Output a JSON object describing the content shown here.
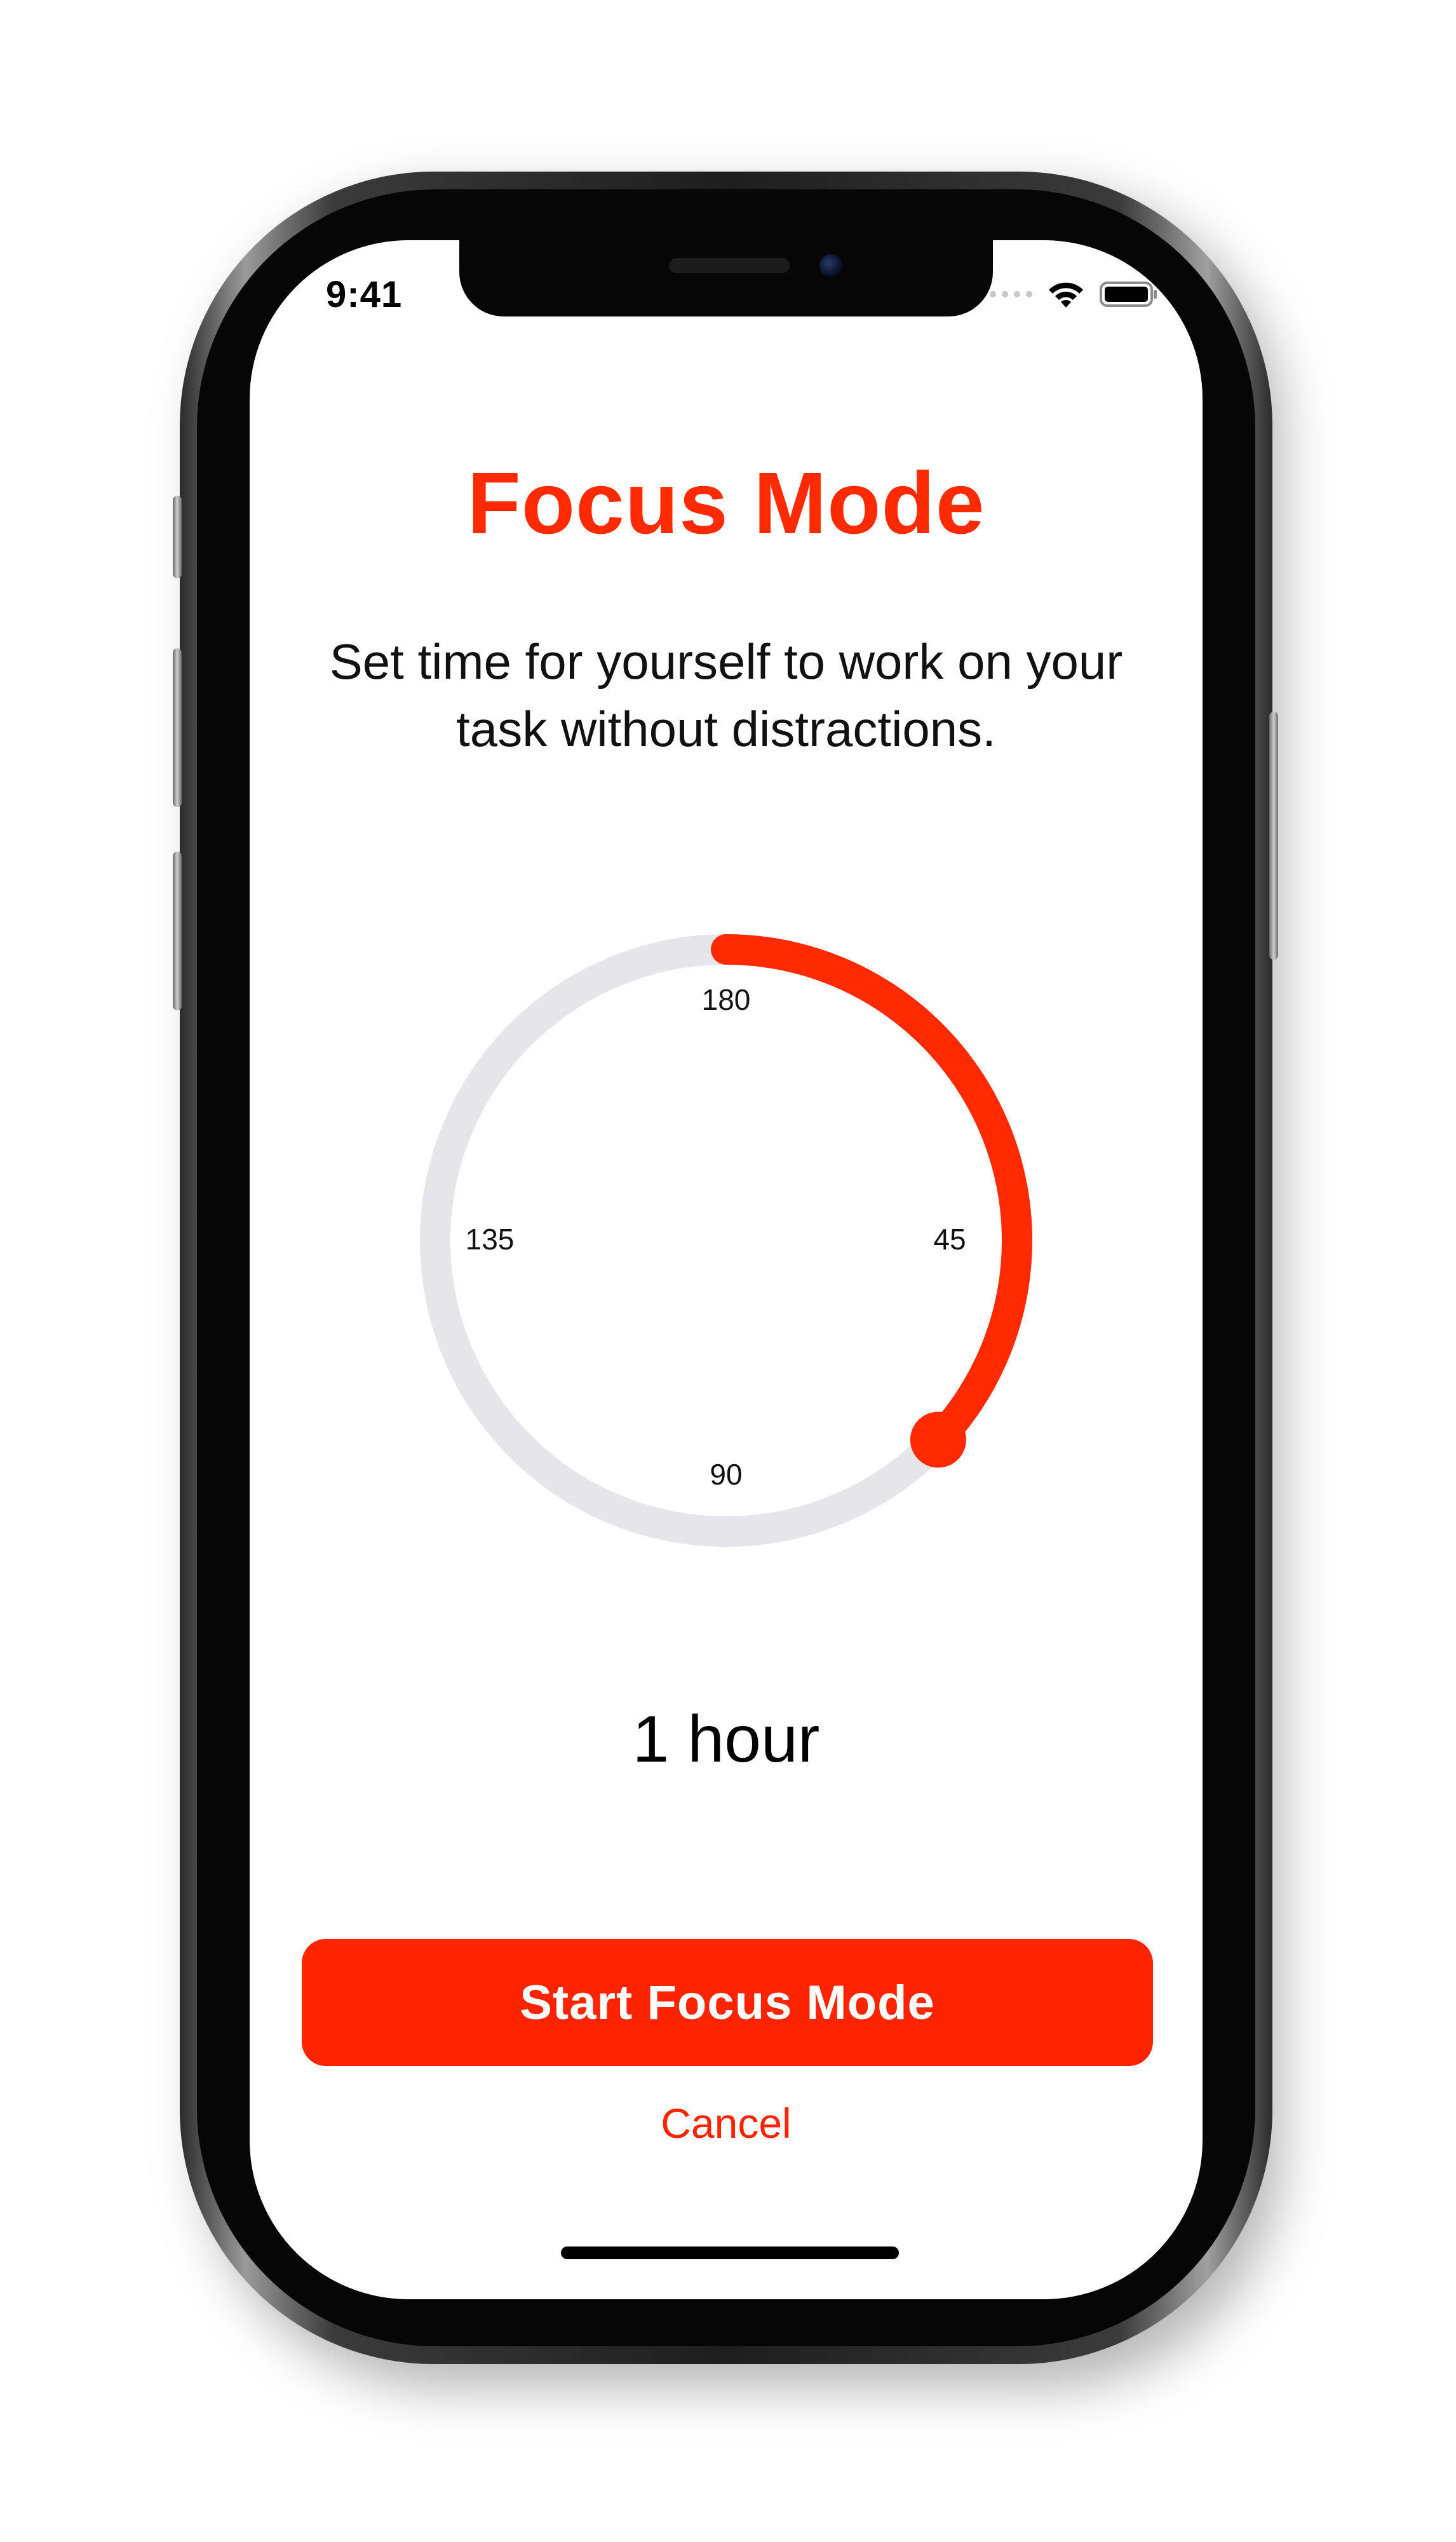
{
  "status_bar": {
    "time": "9:41",
    "icons": [
      "signal-dots-icon",
      "wifi-icon",
      "battery-icon"
    ]
  },
  "main": {
    "title": "Focus Mode",
    "subtitle_line1": "Set time for yourself to work on your",
    "subtitle_line2": "task without distractions.",
    "dial": {
      "labels": {
        "top": "180",
        "right": "45",
        "bottom": "90",
        "left": "135"
      },
      "selected_fraction": 0.37
    },
    "duration": "1 hour",
    "start_button_label": "Start Focus Mode",
    "cancel_label": "Cancel"
  },
  "colors": {
    "accent": "#FF2A00",
    "track": "#E6E6EA",
    "text": "#111111",
    "background": "#FFFFFF"
  }
}
